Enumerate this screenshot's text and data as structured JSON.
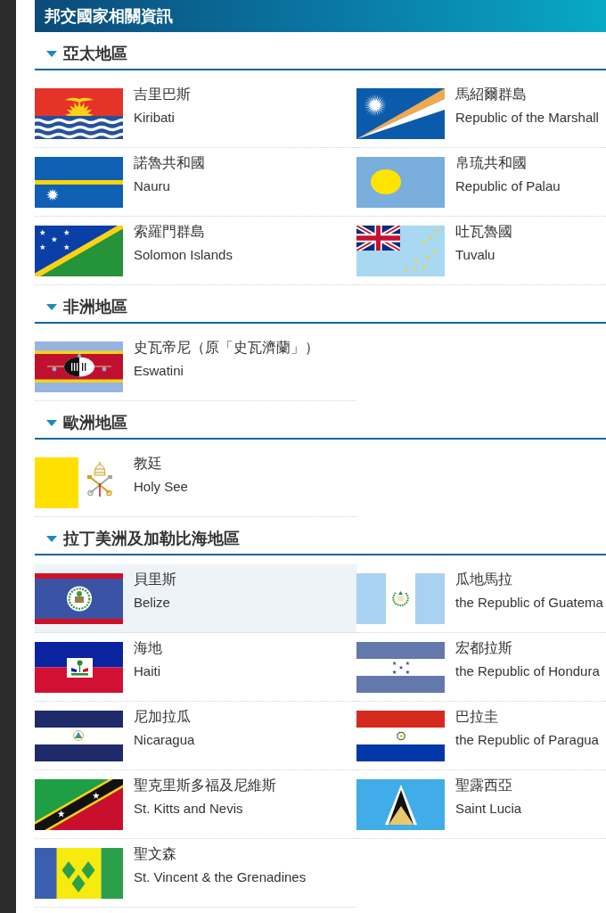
{
  "header": {
    "title": "邦交國家相關資訊"
  },
  "regions": [
    {
      "title": "亞太地區",
      "expanded": true,
      "countries": [
        {
          "name_zh": "吉里巴斯",
          "name_en": "Kiribati",
          "selected": false
        },
        {
          "name_zh": "馬紹爾群島",
          "name_en": "Republic of the Marshall",
          "selected": false
        },
        {
          "name_zh": "諾魯共和國",
          "name_en": "Nauru",
          "selected": false
        },
        {
          "name_zh": "帛琉共和國",
          "name_en": "Republic of Palau",
          "selected": false
        },
        {
          "name_zh": "索羅門群島",
          "name_en": "Solomon Islands",
          "selected": false
        },
        {
          "name_zh": "吐瓦魯國",
          "name_en": "Tuvalu",
          "selected": false
        }
      ]
    },
    {
      "title": "非洲地區",
      "expanded": true,
      "countries": [
        {
          "name_zh": "史瓦帝尼（原「史瓦濟蘭」）",
          "name_en": "Eswatini",
          "selected": false
        }
      ]
    },
    {
      "title": "歐洲地區",
      "expanded": true,
      "countries": [
        {
          "name_zh": "教廷",
          "name_en": "Holy See",
          "selected": false
        }
      ]
    },
    {
      "title": "拉丁美洲及加勒比海地區",
      "expanded": true,
      "countries": [
        {
          "name_zh": "貝里斯",
          "name_en": "Belize",
          "selected": true
        },
        {
          "name_zh": "瓜地馬拉",
          "name_en": "the Republic of Guatema",
          "selected": false
        },
        {
          "name_zh": "海地",
          "name_en": "Haiti",
          "selected": false
        },
        {
          "name_zh": "宏都拉斯",
          "name_en": "the Republic of Hondura",
          "selected": false
        },
        {
          "name_zh": "尼加拉瓜",
          "name_en": "Nicaragua",
          "selected": false
        },
        {
          "name_zh": "巴拉圭",
          "name_en": "the Republic of Paragua",
          "selected": false
        },
        {
          "name_zh": "聖克里斯多福及尼維斯",
          "name_en": "St. Kitts and Nevis",
          "selected": false
        },
        {
          "name_zh": "聖露西亞",
          "name_en": "Saint Lucia",
          "selected": false
        },
        {
          "name_zh": "聖文森",
          "name_en": "St. Vincent & the Grenadines",
          "selected": false
        }
      ]
    }
  ]
}
